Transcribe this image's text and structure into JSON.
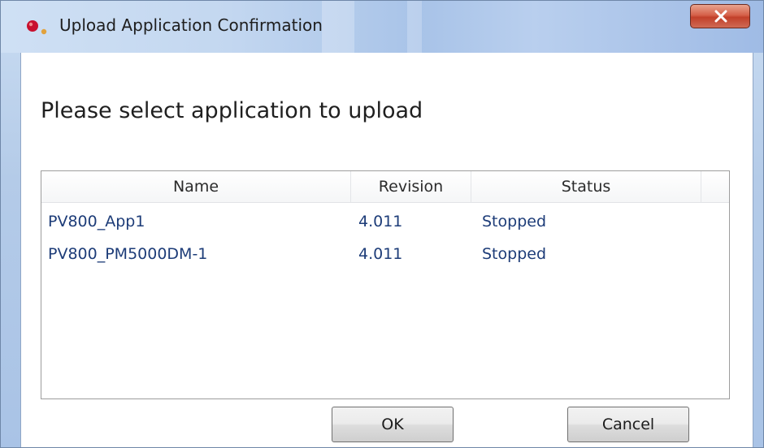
{
  "window": {
    "title": "Upload Application Confirmation",
    "icon": "app-red-dot-icon",
    "close_icon": "close-x-icon",
    "close_color": "#c9452f"
  },
  "prompt": "Please select application to upload",
  "table": {
    "columns": [
      "Name",
      "Revision",
      "Status"
    ],
    "rows": [
      {
        "name": "PV800_App1",
        "revision": "4.011",
        "status": "Stopped"
      },
      {
        "name": "PV800_PM5000DM-1",
        "revision": "4.011",
        "status": "Stopped"
      }
    ],
    "row_text_color": "#1d3c78"
  },
  "buttons": {
    "ok": "OK",
    "cancel": "Cancel"
  }
}
